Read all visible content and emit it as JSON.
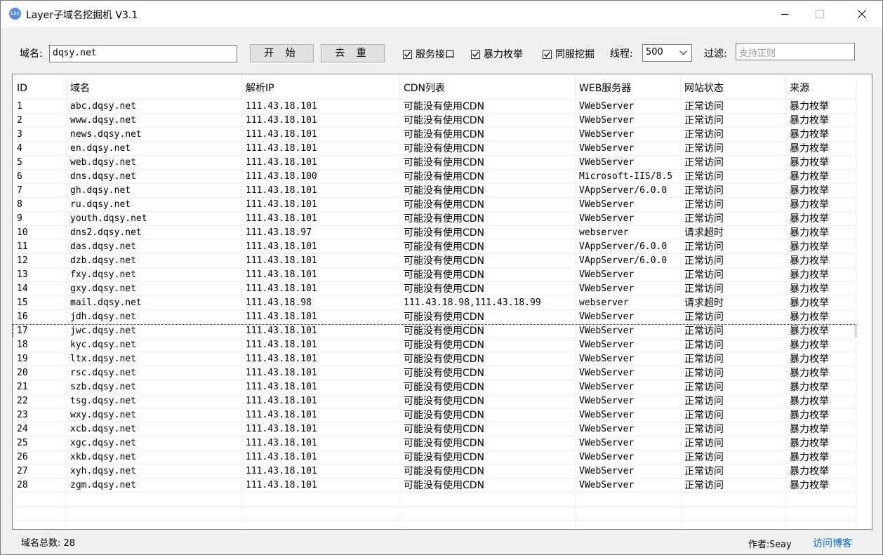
{
  "window": {
    "title": "Layer子域名挖掘机 V3.1",
    "icon_text": "Lay"
  },
  "toolbar": {
    "domain_label": "域名:",
    "domain_value": "dqsy.net",
    "start_label": "开 始",
    "dedupe_label": "去 重",
    "checks": [
      {
        "label": "服务接口",
        "checked": true
      },
      {
        "label": "暴力枚举",
        "checked": true
      },
      {
        "label": "同服挖掘",
        "checked": true
      }
    ],
    "threads_label": "线程:",
    "threads_value": "500",
    "filter_label": "过滤:",
    "filter_placeholder": "支持正则"
  },
  "table": {
    "columns": [
      "ID",
      "域名",
      "解析IP",
      "CDN列表",
      "WEB服务器",
      "网站状态",
      "来源"
    ],
    "rows": [
      [
        "1",
        "abc.dqsy.net",
        "111.43.18.101",
        "可能没有使用CDN",
        "VWebServer",
        "正常访问",
        "暴力枚举"
      ],
      [
        "2",
        "www.dqsy.net",
        "111.43.18.101",
        "可能没有使用CDN",
        "VWebServer",
        "正常访问",
        "暴力枚举"
      ],
      [
        "3",
        "news.dqsy.net",
        "111.43.18.101",
        "可能没有使用CDN",
        "VWebServer",
        "正常访问",
        "暴力枚举"
      ],
      [
        "4",
        "en.dqsy.net",
        "111.43.18.101",
        "可能没有使用CDN",
        "VWebServer",
        "正常访问",
        "暴力枚举"
      ],
      [
        "5",
        "web.dqsy.net",
        "111.43.18.101",
        "可能没有使用CDN",
        "VWebServer",
        "正常访问",
        "暴力枚举"
      ],
      [
        "6",
        "dns.dqsy.net",
        "111.43.18.100",
        "可能没有使用CDN",
        "Microsoft-IIS/8.5",
        "正常访问",
        "暴力枚举"
      ],
      [
        "7",
        "gh.dqsy.net",
        "111.43.18.101",
        "可能没有使用CDN",
        "VAppServer/6.0.0",
        "正常访问",
        "暴力枚举"
      ],
      [
        "8",
        "ru.dqsy.net",
        "111.43.18.101",
        "可能没有使用CDN",
        "VWebServer",
        "正常访问",
        "暴力枚举"
      ],
      [
        "9",
        "youth.dqsy.net",
        "111.43.18.101",
        "可能没有使用CDN",
        "VWebServer",
        "正常访问",
        "暴力枚举"
      ],
      [
        "10",
        "dns2.dqsy.net",
        "111.43.18.97",
        "可能没有使用CDN",
        "webserver",
        "请求超时",
        "暴力枚举"
      ],
      [
        "11",
        "das.dqsy.net",
        "111.43.18.101",
        "可能没有使用CDN",
        "VAppServer/6.0.0",
        "正常访问",
        "暴力枚举"
      ],
      [
        "12",
        "dzb.dqsy.net",
        "111.43.18.101",
        "可能没有使用CDN",
        "VAppServer/6.0.0",
        "正常访问",
        "暴力枚举"
      ],
      [
        "13",
        "fxy.dqsy.net",
        "111.43.18.101",
        "可能没有使用CDN",
        "VWebServer",
        "正常访问",
        "暴力枚举"
      ],
      [
        "14",
        "gxy.dqsy.net",
        "111.43.18.101",
        "可能没有使用CDN",
        "VWebServer",
        "正常访问",
        "暴力枚举"
      ],
      [
        "15",
        "mail.dqsy.net",
        "111.43.18.98",
        "111.43.18.98,111.43.18.99",
        "webserver",
        "请求超时",
        "暴力枚举"
      ],
      [
        "16",
        "jdh.dqsy.net",
        "111.43.18.101",
        "可能没有使用CDN",
        "VWebServer",
        "正常访问",
        "暴力枚举"
      ],
      [
        "17",
        "jwc.dqsy.net",
        "111.43.18.101",
        "可能没有使用CDN",
        "VWebServer",
        "正常访问",
        "暴力枚举"
      ],
      [
        "18",
        "kyc.dqsy.net",
        "111.43.18.101",
        "可能没有使用CDN",
        "VWebServer",
        "正常访问",
        "暴力枚举"
      ],
      [
        "19",
        "ltx.dqsy.net",
        "111.43.18.101",
        "可能没有使用CDN",
        "VWebServer",
        "正常访问",
        "暴力枚举"
      ],
      [
        "20",
        "rsc.dqsy.net",
        "111.43.18.101",
        "可能没有使用CDN",
        "VWebServer",
        "正常访问",
        "暴力枚举"
      ],
      [
        "21",
        "szb.dqsy.net",
        "111.43.18.101",
        "可能没有使用CDN",
        "VWebServer",
        "正常访问",
        "暴力枚举"
      ],
      [
        "22",
        "tsg.dqsy.net",
        "111.43.18.101",
        "可能没有使用CDN",
        "VWebServer",
        "正常访问",
        "暴力枚举"
      ],
      [
        "23",
        "wxy.dqsy.net",
        "111.43.18.101",
        "可能没有使用CDN",
        "VWebServer",
        "正常访问",
        "暴力枚举"
      ],
      [
        "24",
        "xcb.dqsy.net",
        "111.43.18.101",
        "可能没有使用CDN",
        "VWebServer",
        "正常访问",
        "暴力枚举"
      ],
      [
        "25",
        "xgc.dqsy.net",
        "111.43.18.101",
        "可能没有使用CDN",
        "VWebServer",
        "正常访问",
        "暴力枚举"
      ],
      [
        "26",
        "xkb.dqsy.net",
        "111.43.18.101",
        "可能没有使用CDN",
        "VWebServer",
        "正常访问",
        "暴力枚举"
      ],
      [
        "27",
        "xyh.dqsy.net",
        "111.43.18.101",
        "可能没有使用CDN",
        "VWebServer",
        "正常访问",
        "暴力枚举"
      ],
      [
        "28",
        "zgm.dqsy.net",
        "111.43.18.101",
        "可能没有使用CDN",
        "VWebServer",
        "正常访问",
        "暴力枚举"
      ]
    ],
    "focused_row_id": "17"
  },
  "status": {
    "total_label": "域名总数:",
    "total_value": "28",
    "author_label": "作者:",
    "author_value": "Seay",
    "blog_link": "访问博客"
  },
  "colors": {
    "link": "#0066cc",
    "list_border": "#828790",
    "button_bg": "#e1e1e1"
  }
}
